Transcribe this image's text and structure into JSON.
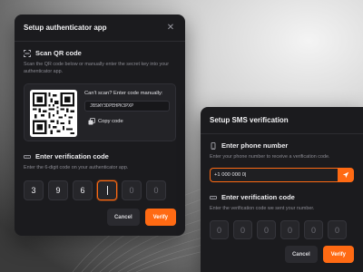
{
  "colors": {
    "accent": "#ff6a13",
    "panel": "#1b1b1e"
  },
  "auth_dialog": {
    "title": "Setup authenticator app",
    "qr_section": {
      "title": "Scan QR code",
      "description": "Scan the QR code below or manually enter the secret key into your authenticator app.",
      "cant_scan": "Can't scan? Enter code manually:",
      "secret_key": "JBSWY3DPEHPK3PXP",
      "copy_label": "Copy code"
    },
    "verify_section": {
      "title": "Enter verification code",
      "description": "Enter the 6-digit code on your authenticator app.",
      "digits": [
        "3",
        "9",
        "6",
        "",
        "0",
        "0"
      ]
    },
    "cancel_label": "Cancel",
    "verify_label": "Verify"
  },
  "sms_dialog": {
    "title": "Setup SMS verification",
    "phone_section": {
      "title": "Enter phone number",
      "description": "Enter your phone number to receive a verification code.",
      "phone_value": "+1 000 000 0|"
    },
    "code_section": {
      "title": "Enter verification code",
      "description": "Enter the verification code we sent your number.",
      "digits": [
        "0",
        "0",
        "0",
        "0",
        "0",
        "0"
      ]
    },
    "cancel_label": "Cancel",
    "verify_label": "Verify"
  }
}
